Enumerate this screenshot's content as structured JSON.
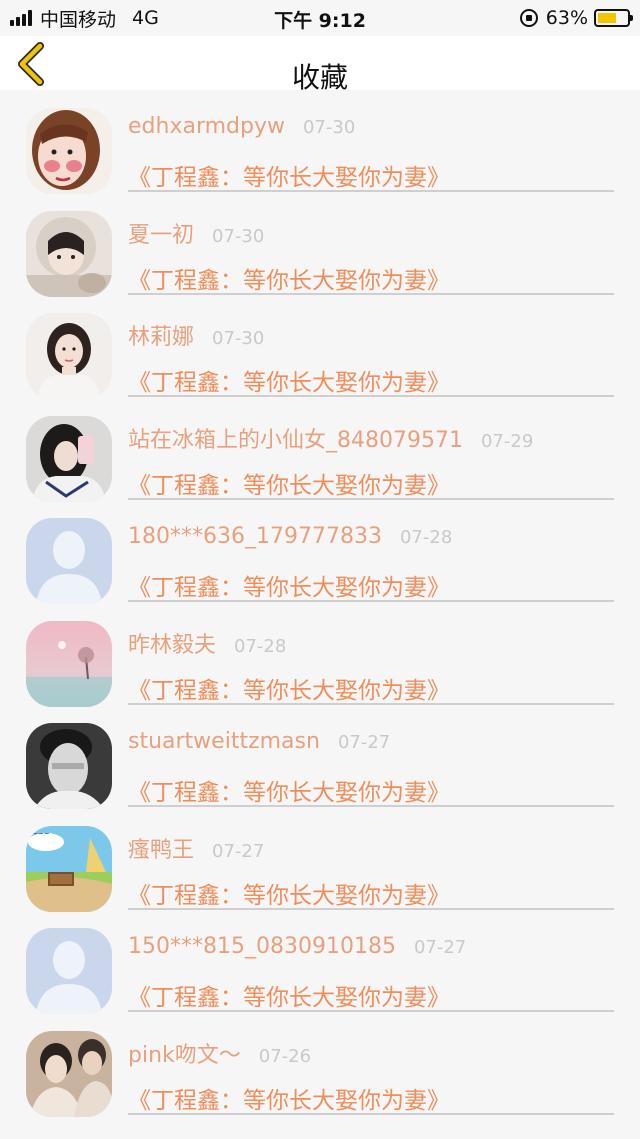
{
  "status_bar": {
    "carrier": "中国移动",
    "network": "4G",
    "time": "下午 9:12",
    "battery_percent": "63%",
    "battery_level": 0.63
  },
  "nav": {
    "back_icon": "chevron-left-icon",
    "title": "收藏"
  },
  "colors": {
    "accent": "#ef8e5a",
    "username": "#e8a17d",
    "back": "#f2c300"
  },
  "items": [
    {
      "username": "edhxarmdpyw",
      "date": "07-30",
      "book_title": "《丁程鑫：等你长大娶你为妻》",
      "avatar": "illustrated-woman"
    },
    {
      "username": "夏一初",
      "date": "07-30",
      "book_title": "《丁程鑫：等你长大娶你为妻》",
      "avatar": "girl-with-hood"
    },
    {
      "username": "林莉娜",
      "date": "07-30",
      "book_title": "《丁程鑫：等你长大娶你为妻》",
      "avatar": "woman-portrait"
    },
    {
      "username": "站在冰箱上的小仙女_848079571",
      "date": "07-29",
      "book_title": "《丁程鑫：等你长大娶你为妻》",
      "avatar": "mirror-selfie"
    },
    {
      "username": "180***636_179777833",
      "date": "07-28",
      "book_title": "《丁程鑫：等你长大娶你为妻》",
      "avatar": "default-avatar"
    },
    {
      "username": "昨林毅夫",
      "date": "07-28",
      "book_title": "《丁程鑫：等你长大娶你为妻》",
      "avatar": "pink-sky-tree"
    },
    {
      "username": "stuartweittzmasn",
      "date": "07-27",
      "book_title": "《丁程鑫：等你长大娶你为妻》",
      "avatar": "bw-man-portrait"
    },
    {
      "username": "瘙鸭王",
      "date": "07-27",
      "book_title": "《丁程鑫：等你长大娶你为妻》",
      "avatar": "cartoon-landscape"
    },
    {
      "username": "150***815_0830910185",
      "date": "07-27",
      "book_title": "《丁程鑫：等你长大娶你为妻》",
      "avatar": "default-avatar"
    },
    {
      "username": "pink吻文～",
      "date": "07-26",
      "book_title": "《丁程鑫：等你长大娶你为妻》",
      "avatar": "two-people-photo"
    }
  ]
}
